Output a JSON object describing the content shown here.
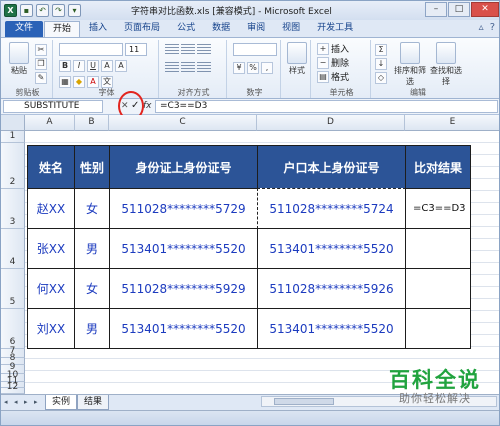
{
  "window": {
    "title": "字符串对比函数.xls  [兼容模式] - Microsoft Excel",
    "minimize": "–",
    "maximize": "□",
    "close": "✕"
  },
  "ribbon_tabs": [
    "文件",
    "开始",
    "插入",
    "页面布局",
    "公式",
    "数据",
    "审阅",
    "视图",
    "开发工具"
  ],
  "ribbon": {
    "paste": "粘贴",
    "clipboard": "剪贴板",
    "font": "字体",
    "alignment": "对齐方式",
    "number": "数字",
    "style": "样式",
    "cells": "单元格",
    "editing": "编辑",
    "insert": "插入",
    "delete": "删除",
    "format": "格式",
    "sort_filter": "排序和筛选",
    "find_select": "查找和选择",
    "font_size": "11"
  },
  "formula_bar": {
    "name_box": "SUBSTITUTE",
    "cancel": "✕",
    "enter": "✓",
    "fx": "fx",
    "formula": "=C3==D3"
  },
  "columns": [
    "A",
    "B",
    "C",
    "D",
    "E"
  ],
  "rows": [
    "1",
    "2",
    "3",
    "4",
    "5",
    "6",
    "7",
    "8",
    "9",
    "10",
    "11",
    "12"
  ],
  "table": {
    "headers": [
      "姓名",
      "性别",
      "身份证上身份证号",
      "户口本上身份证号",
      "比对结果"
    ],
    "rows": [
      [
        "赵XX",
        "女",
        "511028********5729",
        "511028********5724",
        "=C3==D3"
      ],
      [
        "张XX",
        "男",
        "513401********5520",
        "513401********5520",
        ""
      ],
      [
        "何XX",
        "女",
        "511028********5929",
        "511028********5926",
        ""
      ],
      [
        "刘XX",
        "男",
        "513401********5520",
        "513401********5520",
        ""
      ]
    ]
  },
  "sheet_tabs": [
    "实例",
    "结果"
  ],
  "watermark": {
    "line1": "百科全说",
    "line2": "助你轻松解决"
  },
  "colors": {
    "header_fill": "#2c5497",
    "data_text": "#1c3bbf",
    "annotation": "#e2251f",
    "watermark": "#21a33f"
  }
}
